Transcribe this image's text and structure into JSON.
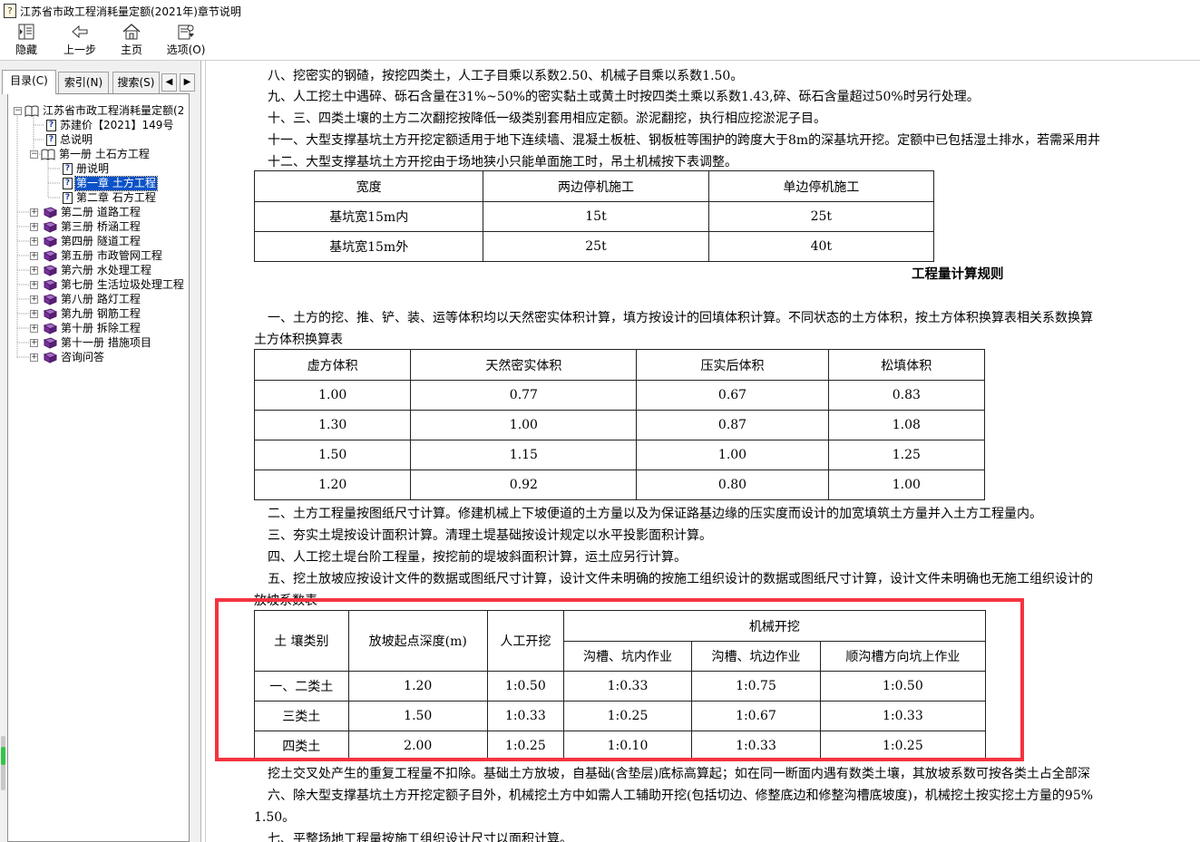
{
  "window": {
    "title": "江苏省市政工程消耗量定额(2021年)章节说明",
    "icon": "help-book-icon"
  },
  "toolbar": {
    "hide": "隐藏",
    "back": "上一步",
    "home": "主页",
    "options": "选项(O)"
  },
  "left_tabs": {
    "contents": "目录(C)",
    "index": "索引(N)",
    "search": "搜索(S)"
  },
  "tree": {
    "root": "江苏省市政工程消耗量定额(2",
    "items": [
      {
        "label": "苏建价【2021】149号"
      },
      {
        "label": "总说明"
      },
      {
        "label": "第一册 土石方工程"
      },
      {
        "label": "册说明"
      },
      {
        "label": "第一章 土方工程"
      },
      {
        "label": "第二章 石方工程"
      },
      {
        "label": "第二册 道路工程"
      },
      {
        "label": "第三册 桥涵工程"
      },
      {
        "label": "第四册 隧道工程"
      },
      {
        "label": "第五册 市政管网工程"
      },
      {
        "label": "第六册 水处理工程"
      },
      {
        "label": "第七册 生活垃圾处理工程"
      },
      {
        "label": "第八册 路灯工程"
      },
      {
        "label": "第九册 钢筋工程"
      },
      {
        "label": "第十册 拆除工程"
      },
      {
        "label": "第十一册 措施项目"
      },
      {
        "label": "咨询问答"
      }
    ]
  },
  "content": {
    "lines_top": [
      "八、挖密实的钢碴，按挖四类土，人工子目乘以系数2.50、机械子目乘以系数1.50。",
      "九、人工挖土中遇碎、砾石含量在31%~50%的密实黏土或黄土时按四类土乘以系数1.43,碎、砾石含量超过50%时另行处理。",
      "十、三、四类土壤的土方二次翻挖按降低一级类别套用相应定额。淤泥翻挖，执行相应挖淤泥子目。",
      "十一、大型支撑基坑土方开挖定额适用于地下连续墙、混凝土板桩、钢板桩等围护的跨度大于8m的深基坑开挖。定额中已包括湿土排水，若需采用井",
      "十二、大型支撑基坑土方开挖由于场地狭小只能单面施工时，吊土机械按下表调整。"
    ],
    "table1": {
      "headers": [
        "宽度",
        "两边停机施工",
        "单边停机施工"
      ],
      "rows": [
        [
          "基坑宽15m内",
          "15t",
          "25t"
        ],
        [
          "基坑宽15m外",
          "25t",
          "40t"
        ]
      ]
    },
    "section_title": "工程量计算规则",
    "rule1": "一、土方的挖、推、铲、装、运等体积均以天然密实体积计算，填方按设计的回填体积计算。不同状态的土方体积，按土方体积换算表相关系数换算",
    "table2_caption": "土方体积换算表",
    "table2": {
      "headers": [
        "虚方体积",
        "天然密实体积",
        "压实后体积",
        "松填体积"
      ],
      "rows": [
        [
          "1.00",
          "0.77",
          "0.67",
          "0.83"
        ],
        [
          "1.30",
          "1.00",
          "0.87",
          "1.08"
        ],
        [
          "1.50",
          "1.15",
          "1.00",
          "1.25"
        ],
        [
          "1.20",
          "0.92",
          "0.80",
          "1.00"
        ]
      ]
    },
    "lines_mid": [
      "二、土方工程量按图纸尺寸计算。修建机械上下坡便道的土方量以及为保证路基边缘的压实度而设计的加宽填筑土方量并入土方工程量内。",
      "三、夯实土堤按设计面积计算。清理土堤基础按设计规定以水平投影面积计算。",
      "四、人工挖土堤台阶工程量，按挖前的堤坡斜面积计算，运土应另行计算。",
      "五、挖土放坡应按设计文件的数据或图纸尺寸计算，设计文件未明确的按施工组织设计的数据或图纸尺寸计算，设计文件未明确也无施工组织设计的"
    ],
    "table3_caption": "放坡系数表",
    "table3": {
      "col1": "土 壤类别",
      "col2": "放坡起点深度(m)",
      "col3": "人工开挖",
      "group": "机械开挖",
      "sub": [
        "沟槽、坑内作业",
        "沟槽、坑边作业",
        "顺沟槽方向坑上作业"
      ],
      "rows": [
        [
          "一、二类土",
          "1.20",
          "1:0.50",
          "1:0.33",
          "1:0.75",
          "1:0.50"
        ],
        [
          "三类土",
          "1.50",
          "1:0.33",
          "1:0.25",
          "1:0.67",
          "1:0.33"
        ],
        [
          "四类土",
          "2.00",
          "1:0.25",
          "1:0.10",
          "1:0.33",
          "1:0.25"
        ]
      ]
    },
    "lines_bottom": [
      "挖土交叉处产生的重复工程量不扣除。基础土方放坡，自基础(含垫层)底标高算起；如在同一断面内遇有数类土壤，其放坡系数可按各类土占全部深",
      "六、除大型支撑基坑土方开挖定额子目外，机械挖土方中如需人工辅助开挖(包括切边、修整底边和修整沟槽底坡度)，机械挖土按实挖土方量的95%",
      "1.50。",
      "七、平整场地工程量按施工组织设计尺寸以面积计算。"
    ]
  },
  "colors": {
    "highlight": "#f5333f",
    "selection": "#0a52c8"
  }
}
